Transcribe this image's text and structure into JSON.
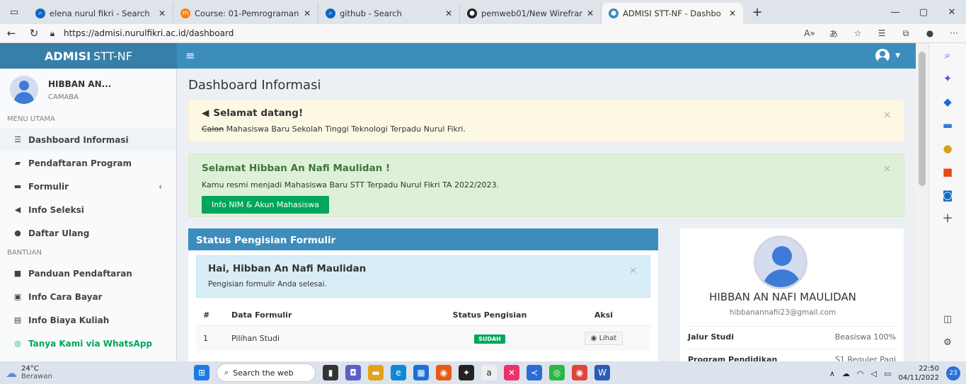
{
  "browser": {
    "tabs": [
      {
        "title": "elena nurul fikri - Search",
        "icon": "search-icon",
        "color": "#0a67c2"
      },
      {
        "title": "Course: 01-Pemrograman",
        "icon": "moodle-icon",
        "color": "#f98012"
      },
      {
        "title": "github - Search",
        "icon": "search-icon",
        "color": "#0a67c2"
      },
      {
        "title": "pemweb01/New Wirefram",
        "icon": "github-icon",
        "color": "#222222"
      },
      {
        "title": "ADMISI STT-NF - Dashbo",
        "icon": "site-icon",
        "color": "#3c8dbc"
      }
    ],
    "url": "https://admisi.nurulfikri.ac.id/dashboard"
  },
  "app": {
    "logo_bold": "ADMISI",
    "logo_rest": "STT-NF"
  },
  "sidebar": {
    "user_name": "HIBBAN AN...",
    "user_role": "CAMABA",
    "section_main": "MENU UTAMA",
    "section_help": "BANTUAN",
    "items_main": [
      {
        "label": "Dashboard Informasi",
        "icon": "list-icon"
      },
      {
        "label": "Pendaftaran Program",
        "icon": "graduation-cap-icon"
      },
      {
        "label": "Formulir",
        "icon": "folder-icon"
      },
      {
        "label": "Info Seleksi",
        "icon": "bullhorn-icon"
      },
      {
        "label": "Daftar Ulang",
        "icon": "user-check-icon"
      }
    ],
    "items_help": [
      {
        "label": "Panduan Pendaftaran",
        "icon": "book-icon"
      },
      {
        "label": "Info Cara Bayar",
        "icon": "money-icon"
      },
      {
        "label": "Info Biaya Kuliah",
        "icon": "tag-icon"
      },
      {
        "label": "Tanya Kami via WhatsApp",
        "icon": "whatsapp-icon"
      }
    ]
  },
  "content": {
    "page_title": "Dashboard Informasi",
    "welcome_title": "Selamat datang!",
    "welcome_strike": "Calon",
    "welcome_text": " Mahasiswa Baru Sekolah Tinggi Teknologi Terpadu Nurul Fikri.",
    "congrats_title": "Selamat Hibban An Nafi Maulidan !",
    "congrats_text": "Kamu resmi menjadi Mahasiswa Baru STT Terpadu Nurul Fikri TA 2022/2023.",
    "nim_button": "Info NIM & Akun Mahasiswa",
    "form_box_title": "Status Pengisian Formulir",
    "form_hai": "Hai, Hibban An Nafi Maulidan",
    "form_status": "Pengisian formulir Anda selesai.",
    "table_headers": [
      "#",
      "Data Formulir",
      "Status Pengisian",
      "Aksi"
    ],
    "table_rows": [
      {
        "no": "1",
        "name": "Pilihan Studi",
        "status": "SUDAH",
        "action": "Lihat"
      }
    ]
  },
  "profile": {
    "name": "HIBBAN AN NAFI MAULIDAN",
    "email": "hibbanannafii23@gmail.com",
    "rows": [
      {
        "label": "Jalur Studi",
        "value": "Beasiswa 100%"
      },
      {
        "label": "Program Pendidikan",
        "value": "S1 Reguler Pagi"
      }
    ]
  },
  "taskbar": {
    "temp": "24°C",
    "weather": "Berawan",
    "search": "Search the web",
    "time": "22:50",
    "date": "04/11/2022",
    "notifications": "23"
  }
}
